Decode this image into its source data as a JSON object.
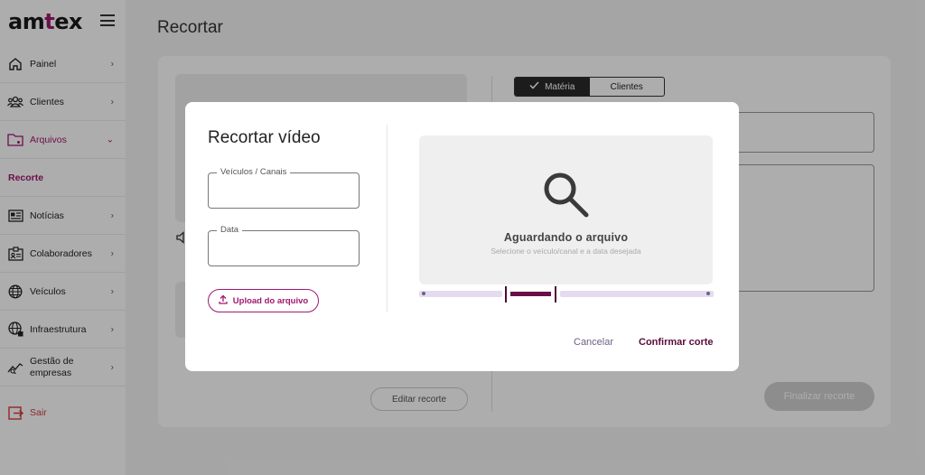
{
  "app": {
    "logo_prefix": "am",
    "logo_accent": "t",
    "logo_suffix": "ex"
  },
  "sidebar": {
    "items": [
      {
        "label": "Painel"
      },
      {
        "label": "Clientes"
      },
      {
        "label": "Arquivos"
      },
      {
        "label": "Recorte"
      },
      {
        "label": "Notícias"
      },
      {
        "label": "Colaboradores"
      },
      {
        "label": "Veículos"
      },
      {
        "label": "Infraestrutura"
      },
      {
        "label_line1": "Gestão de",
        "label_line2": "empresas"
      },
      {
        "label": "Sair"
      }
    ]
  },
  "main": {
    "title": "Recortar",
    "edit_button": "Editar recorte",
    "toggle": {
      "option1": "Matéria",
      "option2": "Clientes"
    },
    "finalize_button": "Finalizar recorte"
  },
  "modal": {
    "title": "Recortar vídeo",
    "field_channels_label": "Veículos / Canais",
    "field_date_label": "Data",
    "upload_button": "Upload do arquivo",
    "placeholder_title": "Aguardando o arquivo",
    "placeholder_subtitle": "Selecione o veículo/canal e a data desejada",
    "cancel_button": "Cancelar",
    "confirm_button": "Confirmar corte"
  },
  "colors": {
    "accent": "#a0186f",
    "danger": "#d43b3b",
    "confirm": "#5a0c3c",
    "track": "#e4dbf0"
  }
}
